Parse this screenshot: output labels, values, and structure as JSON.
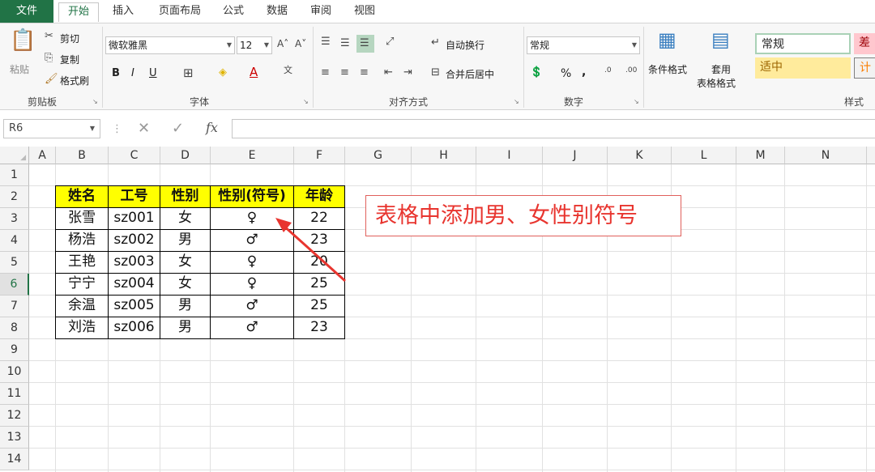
{
  "tabs": [
    "文件",
    "开始",
    "插入",
    "页面布局",
    "公式",
    "数据",
    "审阅",
    "视图"
  ],
  "ribbon": {
    "clipboard": {
      "paste": "粘贴",
      "cut": "剪切",
      "copy": "复制",
      "format_painter": "格式刷",
      "label": "剪贴板"
    },
    "font": {
      "name": "微软雅黑",
      "size": "12",
      "bold": "B",
      "italic": "I",
      "underline": "U",
      "label": "字体"
    },
    "align": {
      "wrap": "自动换行",
      "merge": "合并后居中",
      "label": "对齐方式"
    },
    "number": {
      "format": "常规",
      "percent": "%",
      "comma": ",",
      "label": "数字"
    },
    "styles": {
      "conditional": "条件格式",
      "table_1": "套用",
      "table_2": "表格格式",
      "normal": "常规",
      "bad": "差",
      "neutral": "适中",
      "calc": "计",
      "label": "样式"
    }
  },
  "formula_bar": {
    "name_box": "R6",
    "fx": "fx",
    "value": ""
  },
  "columns": [
    "A",
    "B",
    "C",
    "D",
    "E",
    "F",
    "G",
    "H",
    "I",
    "J",
    "K",
    "L",
    "M",
    "N"
  ],
  "rows": [
    "1",
    "2",
    "3",
    "4",
    "5",
    "6",
    "7",
    "8",
    "9",
    "10",
    "11",
    "12",
    "13",
    "14"
  ],
  "active_row": "6",
  "table": {
    "headers": [
      "姓名",
      "工号",
      "性别",
      "性别(符号)",
      "年龄"
    ],
    "rows": [
      [
        "张雪",
        "sz001",
        "女",
        "♀",
        "22"
      ],
      [
        "杨浩",
        "sz002",
        "男",
        "♂",
        "23"
      ],
      [
        "王艳",
        "sz003",
        "女",
        "♀",
        "20"
      ],
      [
        "宁宁",
        "sz004",
        "女",
        "♀",
        "25"
      ],
      [
        "余温",
        "sz005",
        "男",
        "♂",
        "25"
      ],
      [
        "刘浩",
        "sz006",
        "男",
        "♂",
        "23"
      ]
    ]
  },
  "callout": "表格中添加男、女性别符号",
  "colors": {
    "excel_green": "#217346",
    "header_fill": "#ffff00",
    "callout_red": "#e8352f"
  }
}
